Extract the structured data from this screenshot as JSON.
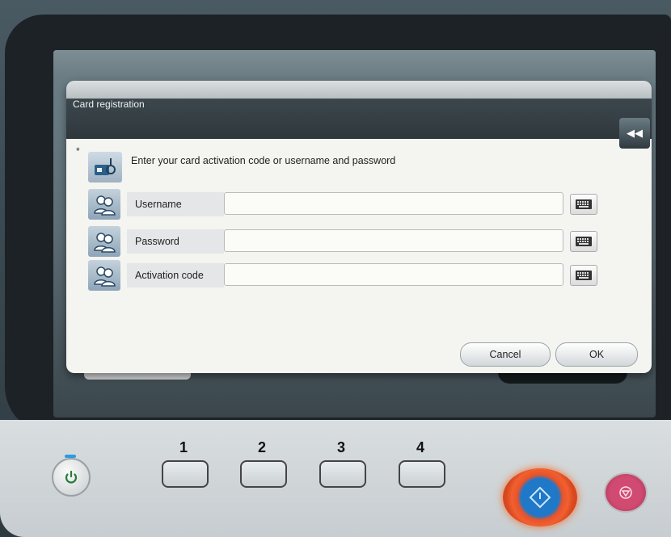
{
  "dialog": {
    "title": "Card registration",
    "instruction": "Enter your card activation code or username and password",
    "required_marker": "*",
    "fields": [
      {
        "label": "Username",
        "value": ""
      },
      {
        "label": "Password",
        "value": ""
      },
      {
        "label": "Activation code",
        "value": ""
      }
    ],
    "cancel_label": "Cancel",
    "ok_label": "OK",
    "back_symbol": "◀◀"
  },
  "panel": {
    "keys": [
      "1",
      "2",
      "3",
      "4"
    ]
  },
  "colors": {
    "start_ring": "#f06030",
    "start_center": "#1f78c8",
    "stop": "#d14a72",
    "power_led": "#2a9ce0"
  }
}
